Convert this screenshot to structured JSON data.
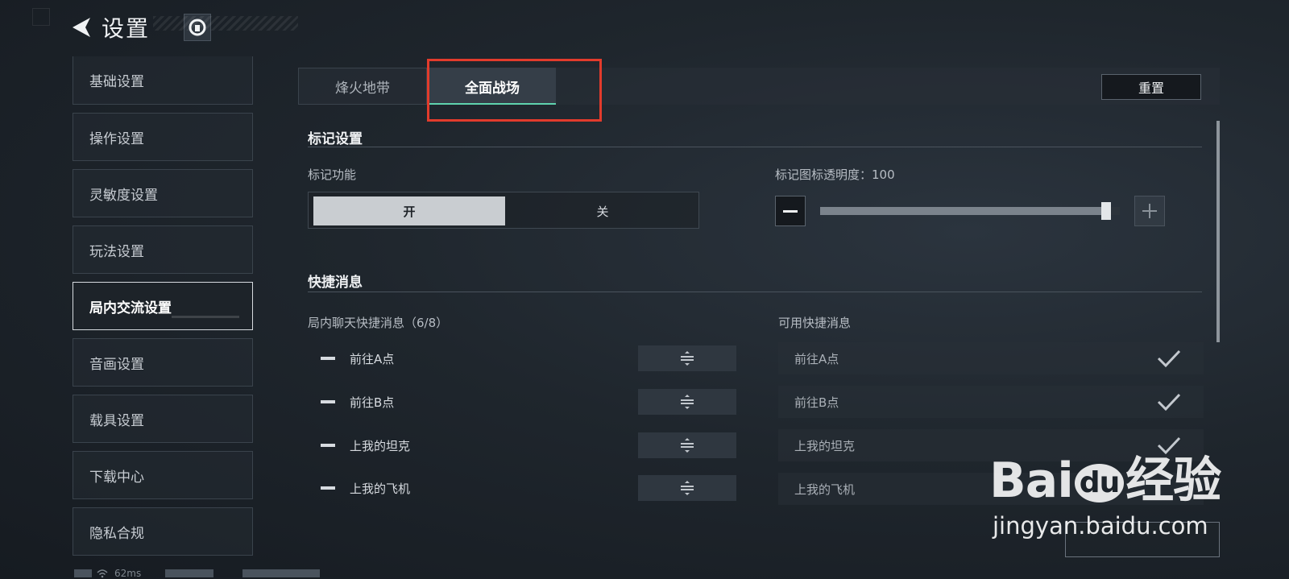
{
  "header": {
    "title": "设置"
  },
  "sidebar": {
    "items": [
      {
        "label": "基础设置"
      },
      {
        "label": "操作设置"
      },
      {
        "label": "灵敏度设置"
      },
      {
        "label": "玩法设置"
      },
      {
        "label": "局内交流设置",
        "active": true
      },
      {
        "label": "音画设置"
      },
      {
        "label": "载具设置"
      },
      {
        "label": "下载中心"
      },
      {
        "label": "隐私合规"
      }
    ]
  },
  "tabs": [
    {
      "label": "烽火地带"
    },
    {
      "label": "全面战场",
      "active": true
    }
  ],
  "reset_label": "重置",
  "marker_section": {
    "title": "标记设置",
    "marker_function_label": "标记功能",
    "on_label": "开",
    "off_label": "关",
    "selected": "开",
    "opacity_label": "标记图标透明度：100",
    "opacity_value": 100
  },
  "quick_msg_section": {
    "title": "快捷消息",
    "chat_label": "局内聊天快捷消息（6/8）",
    "available_label": "可用快捷消息",
    "chat_items": [
      "前往A点",
      "前往B点",
      "上我的坦克",
      "上我的飞机"
    ],
    "available_items": [
      {
        "label": "前往A点",
        "checked": true
      },
      {
        "label": "前往B点",
        "checked": true
      },
      {
        "label": "上我的坦克",
        "checked": true
      },
      {
        "label": "上我的飞机",
        "checked": false
      }
    ]
  },
  "status_bar": {
    "ping": "62ms"
  },
  "watermark": {
    "logo": "Bai",
    "logo_du": "du",
    "logo_cn": "经验",
    "url": "jingyan.baidu.com"
  },
  "colors": {
    "accent": "#5fd3ae",
    "highlight": "#e23b2c"
  }
}
